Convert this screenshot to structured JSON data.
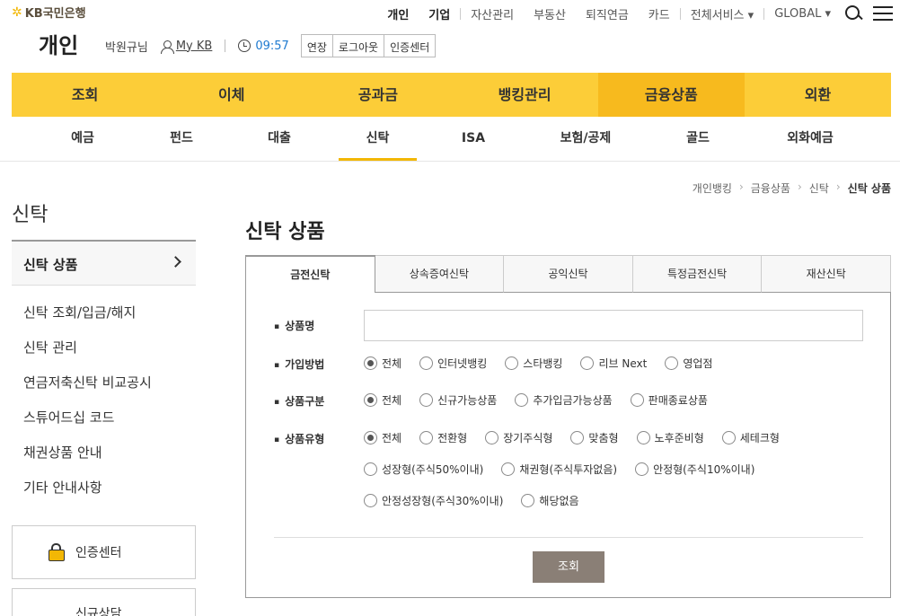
{
  "logo": {
    "star": "✲",
    "text": "KB국민은행"
  },
  "topnav": {
    "personal": "개인",
    "business": "기업",
    "items": [
      "자산관리",
      "부동산",
      "퇴직연금",
      "카드"
    ],
    "all_services": "전체서비스 ▾",
    "global": "GLOBAL ▾"
  },
  "header": {
    "title": "개인",
    "user": "박원규님",
    "mykb": "My KB",
    "timer": "09:57",
    "extend": "연장",
    "logout": "로그아웃",
    "cert": "인증센터"
  },
  "mainnav": [
    "조회",
    "이체",
    "공과금",
    "뱅킹관리",
    "금융상품",
    "외환"
  ],
  "subnav": [
    "예금",
    "펀드",
    "대출",
    "신탁",
    "ISA",
    "보험/공제",
    "골드",
    "외화예금"
  ],
  "breadcrumb": [
    "개인뱅킹",
    "금융상품",
    "신탁",
    "신탁 상품"
  ],
  "sidebar": {
    "title": "신탁",
    "active": "신탁 상품",
    "links": [
      "신탁 조회/입금/해지",
      "신탁 관리",
      "연금저축신탁 비교공시",
      "스튜어드십 코드",
      "채권상품 안내",
      "기타 안내사항"
    ],
    "card1": "인증센터",
    "card2": "신규상담"
  },
  "content": {
    "title": "신탁 상품",
    "tabs": [
      "금전신탁",
      "상속증여신탁",
      "공익신탁",
      "특정금전신탁",
      "재산신탁"
    ],
    "product_name_label": "상품명",
    "join_label": "가입방법",
    "join_options": [
      "전체",
      "인터넷뱅킹",
      "스타뱅킹",
      "리브 Next",
      "영업점"
    ],
    "category_label": "상품구분",
    "category_options": [
      "전체",
      "신규가능상품",
      "추가입금가능상품",
      "판매종료상품"
    ],
    "type_label": "상품유형",
    "type_row1": [
      "전체",
      "전환형",
      "장기주식형",
      "맞춤형",
      "노후준비형",
      "세테크형"
    ],
    "type_row2": [
      "성장형(주식50%이내)",
      "채권형(주식투자없음)",
      "안정형(주식10%이내)"
    ],
    "type_row3": [
      "안정성장형(주식30%이내)",
      "해당없음"
    ],
    "search_button": "조회"
  }
}
